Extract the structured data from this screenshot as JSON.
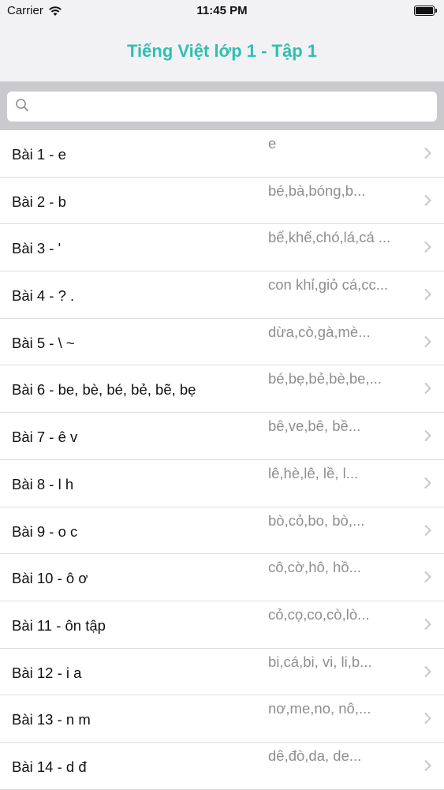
{
  "status_bar": {
    "carrier": "Carrier",
    "time": "11:45 PM"
  },
  "nav": {
    "title": "Tiếng Việt lớp 1 - Tập 1"
  },
  "search": {
    "placeholder": ""
  },
  "lessons": [
    {
      "title": "Bài 1 - e",
      "subtitle": "e"
    },
    {
      "title": "Bài 2 - b",
      "subtitle": "bé,bà,bóng,b..."
    },
    {
      "title": "Bài 3 - '",
      "subtitle": "bế,khế,chó,lá,cá ..."
    },
    {
      "title": "Bài 4 - ? .",
      "subtitle": "con khỉ,giỏ cá,cc..."
    },
    {
      "title": "Bài 5 - \\ ~",
      "subtitle": "dừa,cò,gà,mè..."
    },
    {
      "title": "Bài 6 - be, bè, bé, bẻ, bẽ, bẹ",
      "subtitle": "bé,bẹ,bẻ,bè,be,..."
    },
    {
      "title": "Bài 7 - ê v",
      "subtitle": "bê,ve,bê, bề..."
    },
    {
      "title": "Bài 8 - l h",
      "subtitle": "lê,hè,lê, lề, l..."
    },
    {
      "title": "Bài 9 - o c",
      "subtitle": "bò,cỏ,bo, bò,..."
    },
    {
      "title": "Bài 10 - ô ơ",
      "subtitle": "cô,cờ,hô, hồ..."
    },
    {
      "title": "Bài 11 - ôn tập",
      "subtitle": "cỏ,cọ,co,cò,lò..."
    },
    {
      "title": "Bài 12 - i a",
      "subtitle": "bi,cá,bi, vi, li,b..."
    },
    {
      "title": "Bài 13 - n m",
      "subtitle": "nơ,me,no, nô,..."
    },
    {
      "title": "Bài 14 - d đ",
      "subtitle": "dê,đò,da, de..."
    }
  ]
}
